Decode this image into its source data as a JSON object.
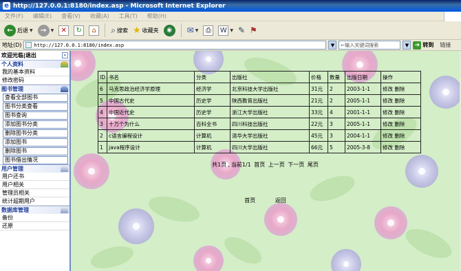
{
  "window": {
    "title": "http://127.0.0.1:8180/index.asp - Microsoft Internet Explorer"
  },
  "menu": [
    "文件(F)",
    "编辑(E)",
    "查看(V)",
    "收藏(A)",
    "工具(T)",
    "帮助(H)"
  ],
  "toolbar": {
    "back": "后退",
    "search": "搜索",
    "favorites": "收藏夹"
  },
  "addressbar": {
    "label": "地址(D)",
    "url": "http://127.0.0.1:8180/index.asp",
    "search_placeholder": "←输入关键词搜索",
    "go": "转到",
    "links": "链接"
  },
  "sidebar": {
    "header": {
      "welcome": "欢迎光临",
      "sep": "|",
      "exit": "退出"
    },
    "sections": [
      {
        "title": "个人资料",
        "items": [
          "我的基本资料",
          "修改密码"
        ],
        "boxed": false
      },
      {
        "title": "图书管理",
        "items": [
          "查看全部图书",
          "图书分类查看",
          "图书查询",
          "添加图书分类",
          "删除图书分类",
          "添加图书",
          "删除图书",
          "图书借出情况"
        ],
        "boxed": true
      },
      {
        "title": "用户管理",
        "items": [
          "用户还书",
          "用户相关",
          "管理员相关",
          "统计超期用户"
        ],
        "boxed": false
      },
      {
        "title": "数据库管理",
        "items": [
          "备份",
          "还原"
        ],
        "boxed": false
      }
    ]
  },
  "table": {
    "headers": [
      "ID",
      "书名",
      "分类",
      "出版社",
      "价格",
      "数量",
      "出版日期",
      "操作"
    ],
    "rows": [
      [
        "6",
        "马克思政治经济学原理",
        "经济学",
        "北京科技大学出版社",
        "31元",
        "2",
        "2003-1-1",
        "修改",
        "删除"
      ],
      [
        "5",
        "中国古代史",
        "历史学",
        "陕西教育出版社",
        "21元",
        "2",
        "2005-1-1",
        "修改",
        "删除"
      ],
      [
        "4",
        "中国近代史",
        "历史学",
        "浙江大学出版社",
        "33元",
        "4",
        "2001-1-1",
        "修改",
        "删除"
      ],
      [
        "3",
        "十万个为什么",
        "百科全书",
        "四川科技出版社",
        "22元",
        "3",
        "2005-1-1",
        "修改",
        "删除"
      ],
      [
        "2",
        "c语言编程设计",
        "计算机",
        "清华大学出版社",
        "45元",
        "3",
        "2004-1-1",
        "修改",
        "删除"
      ],
      [
        "1",
        "java程序设计",
        "计算机",
        "四川大学出版社",
        "66元",
        "5",
        "2005-3-8",
        "修改",
        "删除"
      ]
    ]
  },
  "pager": {
    "total": "共1页",
    "current": "当前1/1",
    "first": "首页",
    "prev": "上一页",
    "next": "下一页",
    "last": "尾页"
  },
  "footer": {
    "home": "首页",
    "back": "返回"
  },
  "colors": {
    "title_bar": "#0A246A",
    "page_bg": "#d8f0cc",
    "section_text": "#1f3f9a"
  }
}
